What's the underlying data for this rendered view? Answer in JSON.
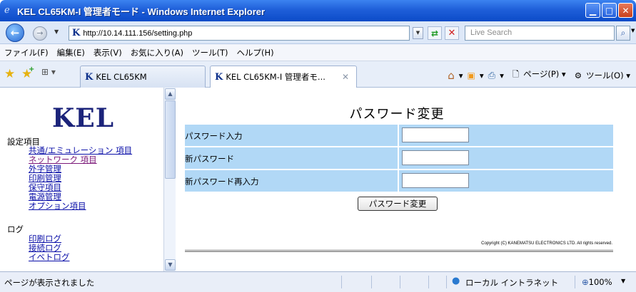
{
  "window": {
    "title": "KEL CL65KM-I 管理者モード - Windows Internet Explorer",
    "buttons": [
      "minimize",
      "maximize",
      "close"
    ]
  },
  "address_bar": {
    "url": "http://10.14.111.156/setting.php",
    "search_placeholder": "Live Search"
  },
  "menu": [
    "ファイル(F)",
    "編集(E)",
    "表示(V)",
    "お気に入り(A)",
    "ツール(T)",
    "ヘルプ(H)"
  ],
  "tabs": [
    {
      "label": "KEL CL65KM",
      "active": false
    },
    {
      "label": "KEL CL65KM-I 管理者モ...",
      "active": true
    }
  ],
  "command_bar": {
    "page_label": "ページ(P)",
    "tools_label": "ツール(O)"
  },
  "sidebar": {
    "logo": "KEL",
    "settings_heading": "設定項目",
    "settings_items": [
      {
        "label": "共通/エミュレーション 項目",
        "visited": false
      },
      {
        "label": "ネットワーク 項目",
        "visited": true
      },
      {
        "label": "外字管理",
        "visited": false
      },
      {
        "label": "印刷管理",
        "visited": false
      },
      {
        "label": "保守項目",
        "visited": false
      },
      {
        "label": "電源管理",
        "visited": false
      },
      {
        "label": "オプション項目",
        "visited": false
      }
    ],
    "log_heading": "ログ",
    "log_items": [
      {
        "label": "印刷ログ"
      },
      {
        "label": "接続ログ"
      },
      {
        "label": "イベトログ"
      }
    ]
  },
  "main": {
    "page_title": "パスワード変更",
    "fields": [
      {
        "label": "パスワード入力",
        "value": ""
      },
      {
        "label": "新パスワード",
        "value": ""
      },
      {
        "label": "新パスワード再入力",
        "value": ""
      }
    ],
    "submit_label": "パスワード変更",
    "copyright": "Copyright (C) KANEMATSU ELECTRONICS LTD. All rights reserved."
  },
  "status_bar": {
    "status": "ページが表示されました",
    "zone": "ローカル イントラネット",
    "zoom": "100%"
  },
  "colors": {
    "title_bar": "#1f5fd9",
    "form_row": "#b1d8f6",
    "logo": "#1b237a",
    "link": "#0a0fa8",
    "visited_link": "#7b1878"
  }
}
